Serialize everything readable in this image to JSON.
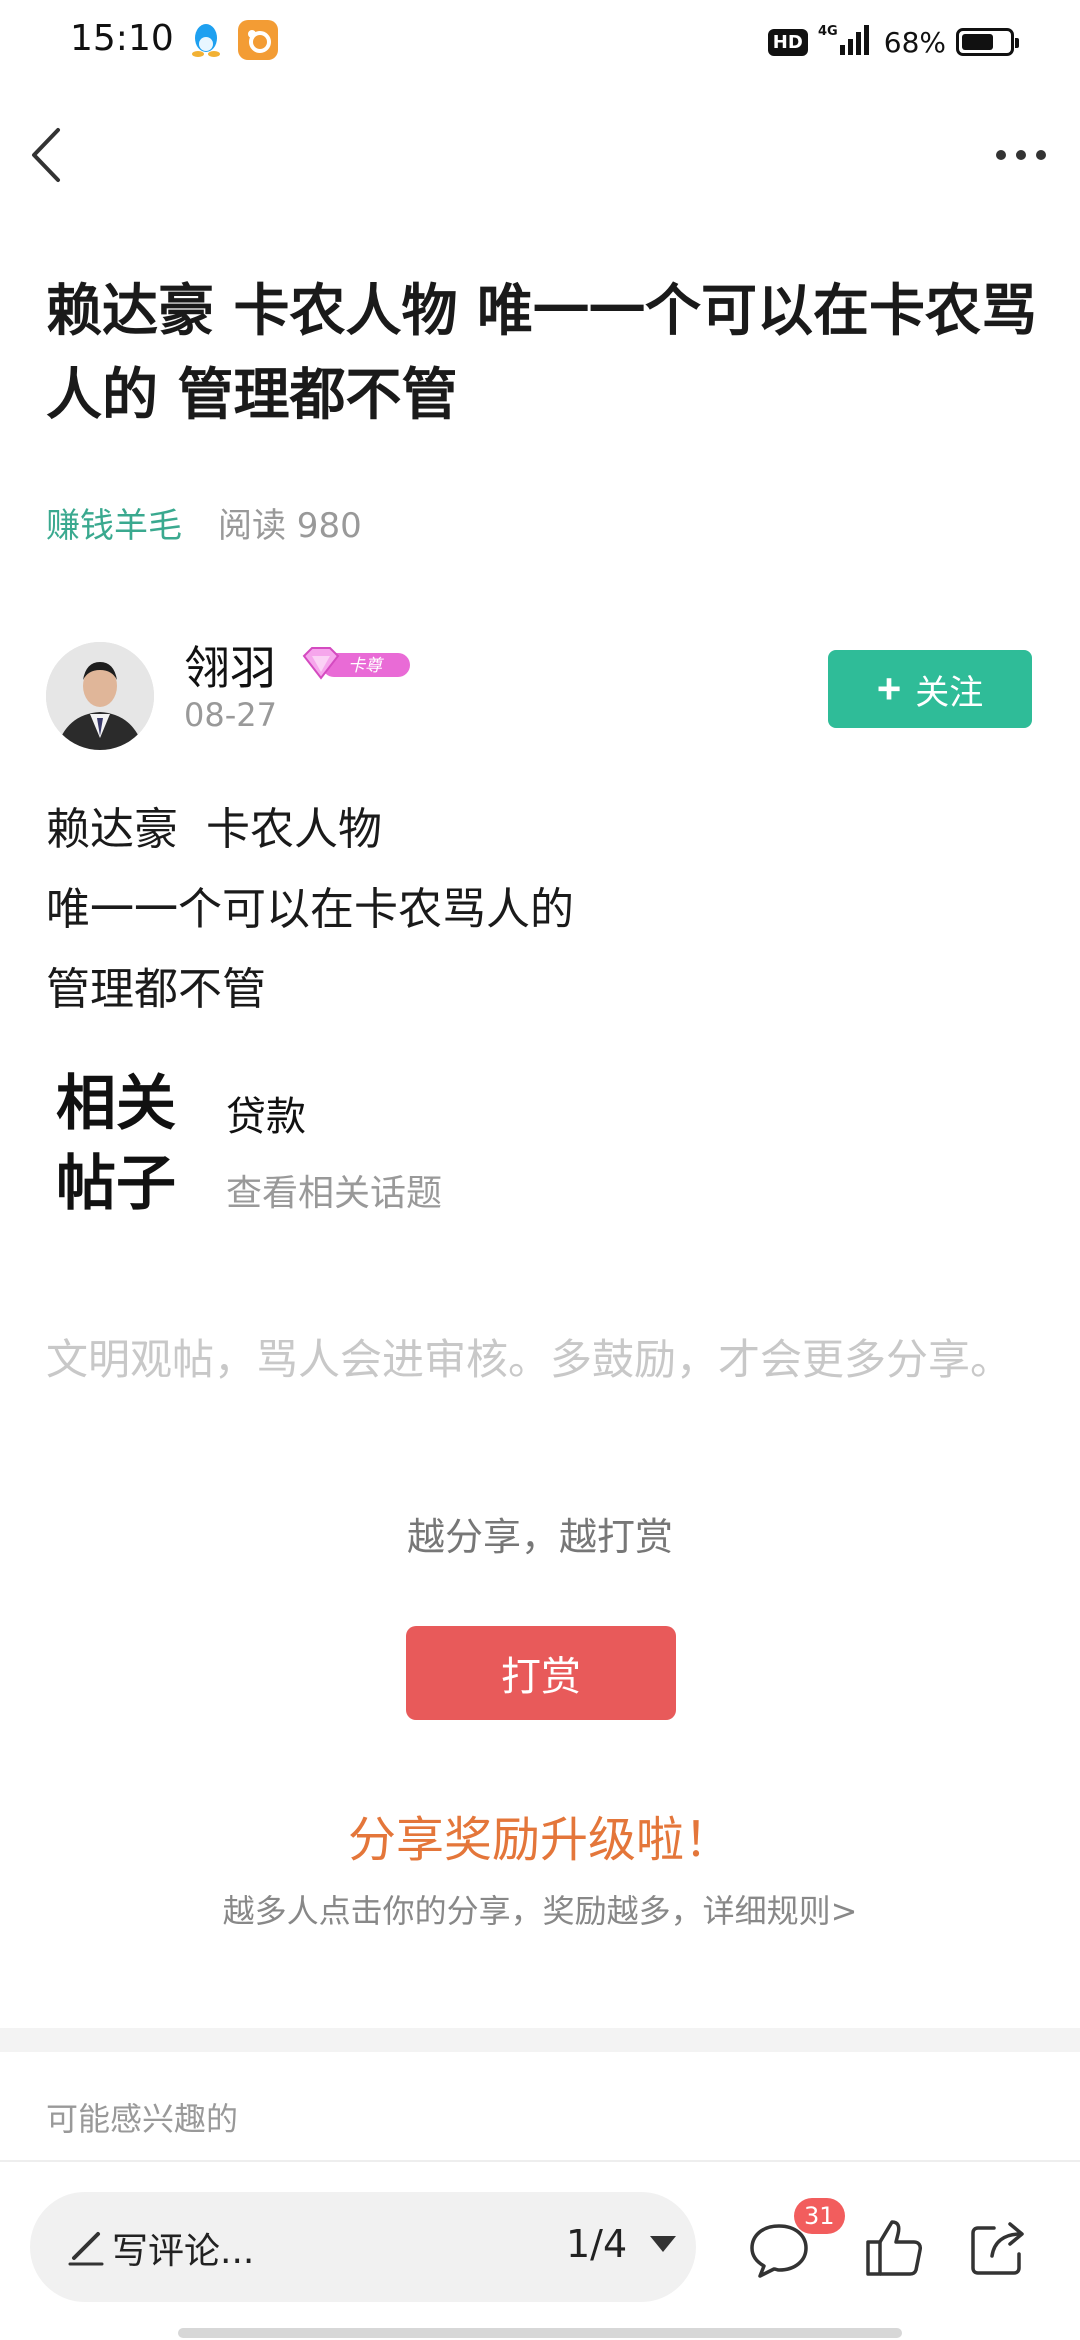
{
  "status_bar": {
    "time": "15:10",
    "network": "4G",
    "hd_label": "HD",
    "battery": "68%",
    "battery_level": 0.68,
    "app_icons": [
      "qq-penguin-icon",
      "uc-browser-icon"
    ]
  },
  "nav": {
    "back_icon": "back-arrow-icon",
    "more_icon": "more-dots-icon"
  },
  "post": {
    "title": "赖达豪 卡农人物 唯一一个可以在卡农骂人的 管理都不管",
    "topic": "赚钱羊毛",
    "read_count": "阅读 980",
    "author": {
      "name": "翎羽",
      "badge": "卡尊",
      "date": "08-27",
      "follow_label": "关注"
    },
    "body_lines": [
      "赖达豪  卡农人物",
      "唯一一个可以在卡农骂人的",
      "管理都不管"
    ]
  },
  "related": {
    "label_line1": "相关",
    "label_line2": "帖子",
    "tag": "贷款",
    "more": "查看相关话题"
  },
  "civility_note": "文明观帖，骂人会进审核。多鼓励，才会更多分享。",
  "tip": {
    "prompt": "越分享，越打赏",
    "button": "打赏"
  },
  "share": {
    "title": "分享奖励升级啦！",
    "subtitle": "越多人点击你的分享，奖励越多，详细规则>"
  },
  "interest": {
    "title": "可能感兴趣的"
  },
  "bottom_bar": {
    "comment_placeholder": "写评论...",
    "page_indicator": "1/4",
    "comment_count": "31"
  },
  "colors": {
    "accent_green": "#2fbc98",
    "topic_green": "#3aa98f",
    "tip_red": "#e85a5a",
    "share_orange": "#e4763a",
    "badge_pink": "#e96bd6"
  }
}
